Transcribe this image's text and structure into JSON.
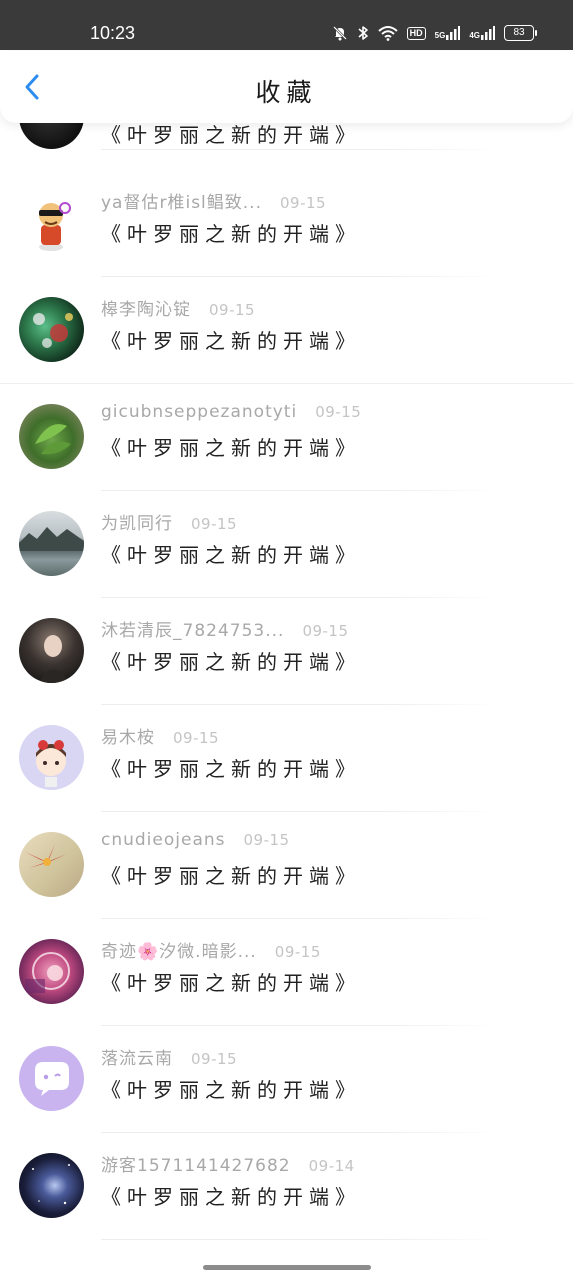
{
  "status_bar": {
    "time": "10:23",
    "battery": "83",
    "hd_label": "HD",
    "signal_1_label": "5G",
    "signal_2_label": "4G",
    "icons": [
      "mute-bell-icon",
      "bluetooth-icon",
      "wifi-icon",
      "hd-icon",
      "signal-5g-icon",
      "signal-4g-icon",
      "battery-icon"
    ]
  },
  "header": {
    "title": "收藏",
    "back_icon": "chevron-left-icon",
    "accent_color": "#2d8cf0"
  },
  "favorites": [
    {
      "name": "",
      "date": "",
      "title": "《叶罗丽之新的开端》"
    },
    {
      "name": "ya督估r椎isl鲳致...",
      "date": "09-15",
      "title": "《叶罗丽之新的开端》"
    },
    {
      "name": "槔李陶沁锭",
      "date": "09-15",
      "title": "《叶罗丽之新的开端》"
    },
    {
      "name": "gicubnseppezanotyti",
      "date": "09-15",
      "title": "《叶罗丽之新的开端》"
    },
    {
      "name": "为凯同行",
      "date": "09-15",
      "title": "《叶罗丽之新的开端》"
    },
    {
      "name": "沐若清辰_7824753...",
      "date": "09-15",
      "title": "《叶罗丽之新的开端》"
    },
    {
      "name": "易木桉",
      "date": "09-15",
      "title": "《叶罗丽之新的开端》"
    },
    {
      "name": "cnudieojeans",
      "date": "09-15",
      "title": "《叶罗丽之新的开端》"
    },
    {
      "name": "奇迹🌸汐微.暗影...",
      "date": "09-15",
      "title": "《叶罗丽之新的开端》"
    },
    {
      "name": "落流云南",
      "date": "09-15",
      "title": "《叶罗丽之新的开端》"
    },
    {
      "name": "游客1571141427682",
      "date": "09-14",
      "title": "《叶罗丽之新的开端》"
    }
  ]
}
